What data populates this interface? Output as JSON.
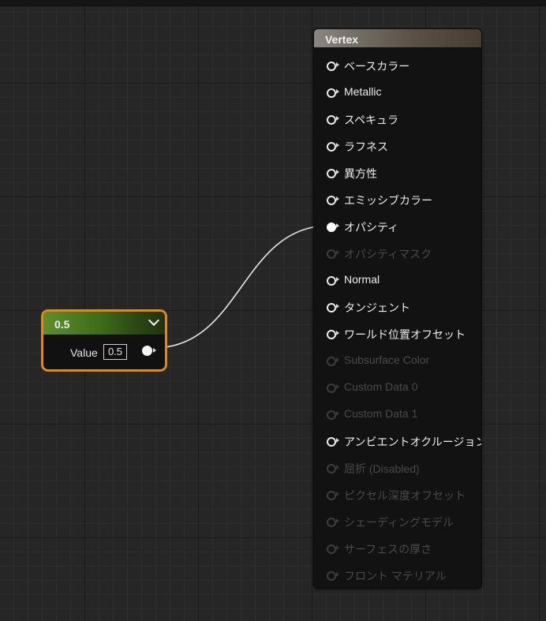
{
  "constant_node": {
    "title": "0.5",
    "value_label": "Value",
    "value": "0.5"
  },
  "result_node": {
    "title": "Vertex",
    "pins": [
      {
        "label": "ベースカラー",
        "state": "enabled"
      },
      {
        "label": "Metallic",
        "state": "enabled"
      },
      {
        "label": "スペキュラ",
        "state": "enabled"
      },
      {
        "label": "ラフネス",
        "state": "enabled"
      },
      {
        "label": "異方性",
        "state": "enabled"
      },
      {
        "label": "エミッシブカラー",
        "state": "enabled"
      },
      {
        "label": "オパシティ",
        "state": "connected"
      },
      {
        "label": "オパシティマスク",
        "state": "disabled"
      },
      {
        "label": "Normal",
        "state": "enabled"
      },
      {
        "label": "タンジェント",
        "state": "enabled"
      },
      {
        "label": "ワールド位置オフセット",
        "state": "enabled"
      },
      {
        "label": "Subsurface Color",
        "state": "disabled"
      },
      {
        "label": "Custom Data 0",
        "state": "disabled"
      },
      {
        "label": "Custom Data 1",
        "state": "disabled"
      },
      {
        "label": "アンビエントオクルージョン",
        "state": "enabled"
      },
      {
        "label": "屈折 (Disabled)",
        "state": "disabled"
      },
      {
        "label": "ピクセル深度オフセット",
        "state": "disabled"
      },
      {
        "label": "シェーディングモデル",
        "state": "disabled"
      },
      {
        "label": "サーフェスの厚さ",
        "state": "disabled"
      },
      {
        "label": "フロント マテリアル",
        "state": "disabled"
      }
    ]
  },
  "connection": {
    "from": "constant_node.output",
    "to": "オパシティ"
  },
  "colors": {
    "constant_header": "#4a7a22",
    "selection_outline": "#e08a14",
    "result_header": "#6e6860",
    "wire": "#e6e6e6"
  }
}
